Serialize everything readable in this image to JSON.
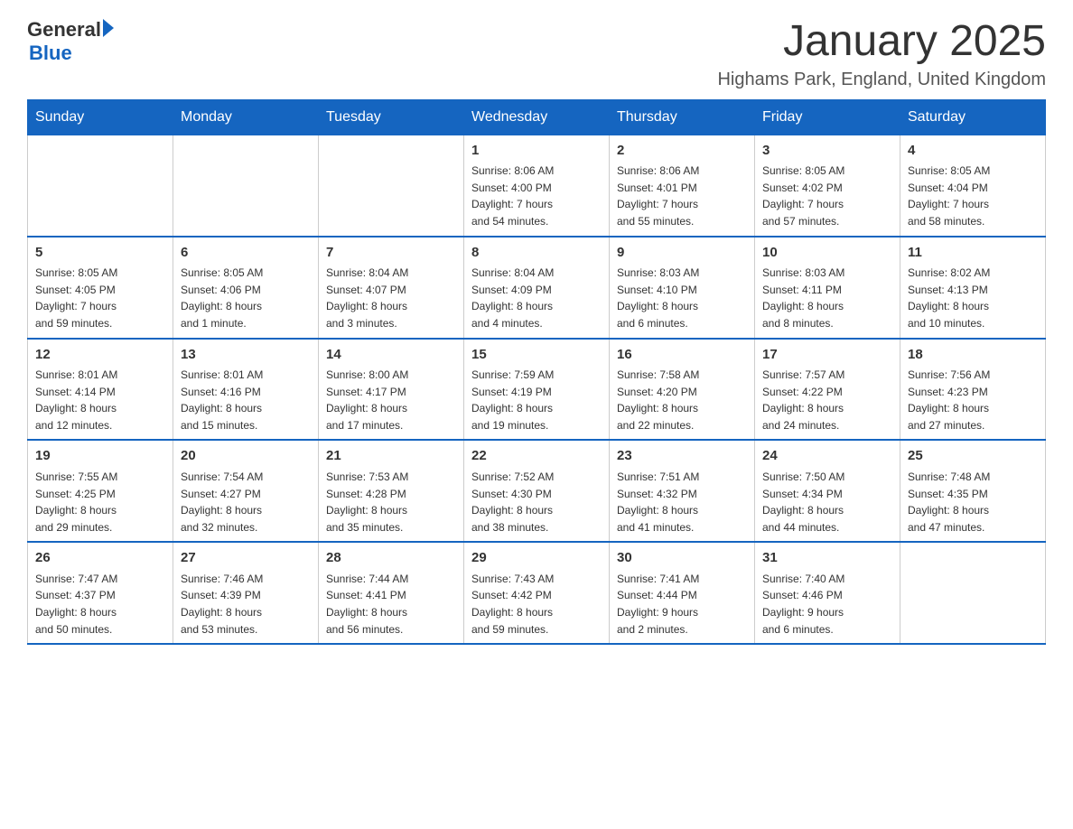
{
  "logo": {
    "text_general": "General",
    "text_blue": "Blue",
    "line2": "Blue"
  },
  "title": "January 2025",
  "subtitle": "Highams Park, England, United Kingdom",
  "days_of_week": [
    "Sunday",
    "Monday",
    "Tuesday",
    "Wednesday",
    "Thursday",
    "Friday",
    "Saturday"
  ],
  "weeks": [
    [
      {
        "day": "",
        "info": ""
      },
      {
        "day": "",
        "info": ""
      },
      {
        "day": "",
        "info": ""
      },
      {
        "day": "1",
        "info": "Sunrise: 8:06 AM\nSunset: 4:00 PM\nDaylight: 7 hours\nand 54 minutes."
      },
      {
        "day": "2",
        "info": "Sunrise: 8:06 AM\nSunset: 4:01 PM\nDaylight: 7 hours\nand 55 minutes."
      },
      {
        "day": "3",
        "info": "Sunrise: 8:05 AM\nSunset: 4:02 PM\nDaylight: 7 hours\nand 57 minutes."
      },
      {
        "day": "4",
        "info": "Sunrise: 8:05 AM\nSunset: 4:04 PM\nDaylight: 7 hours\nand 58 minutes."
      }
    ],
    [
      {
        "day": "5",
        "info": "Sunrise: 8:05 AM\nSunset: 4:05 PM\nDaylight: 7 hours\nand 59 minutes."
      },
      {
        "day": "6",
        "info": "Sunrise: 8:05 AM\nSunset: 4:06 PM\nDaylight: 8 hours\nand 1 minute."
      },
      {
        "day": "7",
        "info": "Sunrise: 8:04 AM\nSunset: 4:07 PM\nDaylight: 8 hours\nand 3 minutes."
      },
      {
        "day": "8",
        "info": "Sunrise: 8:04 AM\nSunset: 4:09 PM\nDaylight: 8 hours\nand 4 minutes."
      },
      {
        "day": "9",
        "info": "Sunrise: 8:03 AM\nSunset: 4:10 PM\nDaylight: 8 hours\nand 6 minutes."
      },
      {
        "day": "10",
        "info": "Sunrise: 8:03 AM\nSunset: 4:11 PM\nDaylight: 8 hours\nand 8 minutes."
      },
      {
        "day": "11",
        "info": "Sunrise: 8:02 AM\nSunset: 4:13 PM\nDaylight: 8 hours\nand 10 minutes."
      }
    ],
    [
      {
        "day": "12",
        "info": "Sunrise: 8:01 AM\nSunset: 4:14 PM\nDaylight: 8 hours\nand 12 minutes."
      },
      {
        "day": "13",
        "info": "Sunrise: 8:01 AM\nSunset: 4:16 PM\nDaylight: 8 hours\nand 15 minutes."
      },
      {
        "day": "14",
        "info": "Sunrise: 8:00 AM\nSunset: 4:17 PM\nDaylight: 8 hours\nand 17 minutes."
      },
      {
        "day": "15",
        "info": "Sunrise: 7:59 AM\nSunset: 4:19 PM\nDaylight: 8 hours\nand 19 minutes."
      },
      {
        "day": "16",
        "info": "Sunrise: 7:58 AM\nSunset: 4:20 PM\nDaylight: 8 hours\nand 22 minutes."
      },
      {
        "day": "17",
        "info": "Sunrise: 7:57 AM\nSunset: 4:22 PM\nDaylight: 8 hours\nand 24 minutes."
      },
      {
        "day": "18",
        "info": "Sunrise: 7:56 AM\nSunset: 4:23 PM\nDaylight: 8 hours\nand 27 minutes."
      }
    ],
    [
      {
        "day": "19",
        "info": "Sunrise: 7:55 AM\nSunset: 4:25 PM\nDaylight: 8 hours\nand 29 minutes."
      },
      {
        "day": "20",
        "info": "Sunrise: 7:54 AM\nSunset: 4:27 PM\nDaylight: 8 hours\nand 32 minutes."
      },
      {
        "day": "21",
        "info": "Sunrise: 7:53 AM\nSunset: 4:28 PM\nDaylight: 8 hours\nand 35 minutes."
      },
      {
        "day": "22",
        "info": "Sunrise: 7:52 AM\nSunset: 4:30 PM\nDaylight: 8 hours\nand 38 minutes."
      },
      {
        "day": "23",
        "info": "Sunrise: 7:51 AM\nSunset: 4:32 PM\nDaylight: 8 hours\nand 41 minutes."
      },
      {
        "day": "24",
        "info": "Sunrise: 7:50 AM\nSunset: 4:34 PM\nDaylight: 8 hours\nand 44 minutes."
      },
      {
        "day": "25",
        "info": "Sunrise: 7:48 AM\nSunset: 4:35 PM\nDaylight: 8 hours\nand 47 minutes."
      }
    ],
    [
      {
        "day": "26",
        "info": "Sunrise: 7:47 AM\nSunset: 4:37 PM\nDaylight: 8 hours\nand 50 minutes."
      },
      {
        "day": "27",
        "info": "Sunrise: 7:46 AM\nSunset: 4:39 PM\nDaylight: 8 hours\nand 53 minutes."
      },
      {
        "day": "28",
        "info": "Sunrise: 7:44 AM\nSunset: 4:41 PM\nDaylight: 8 hours\nand 56 minutes."
      },
      {
        "day": "29",
        "info": "Sunrise: 7:43 AM\nSunset: 4:42 PM\nDaylight: 8 hours\nand 59 minutes."
      },
      {
        "day": "30",
        "info": "Sunrise: 7:41 AM\nSunset: 4:44 PM\nDaylight: 9 hours\nand 2 minutes."
      },
      {
        "day": "31",
        "info": "Sunrise: 7:40 AM\nSunset: 4:46 PM\nDaylight: 9 hours\nand 6 minutes."
      },
      {
        "day": "",
        "info": ""
      }
    ]
  ]
}
